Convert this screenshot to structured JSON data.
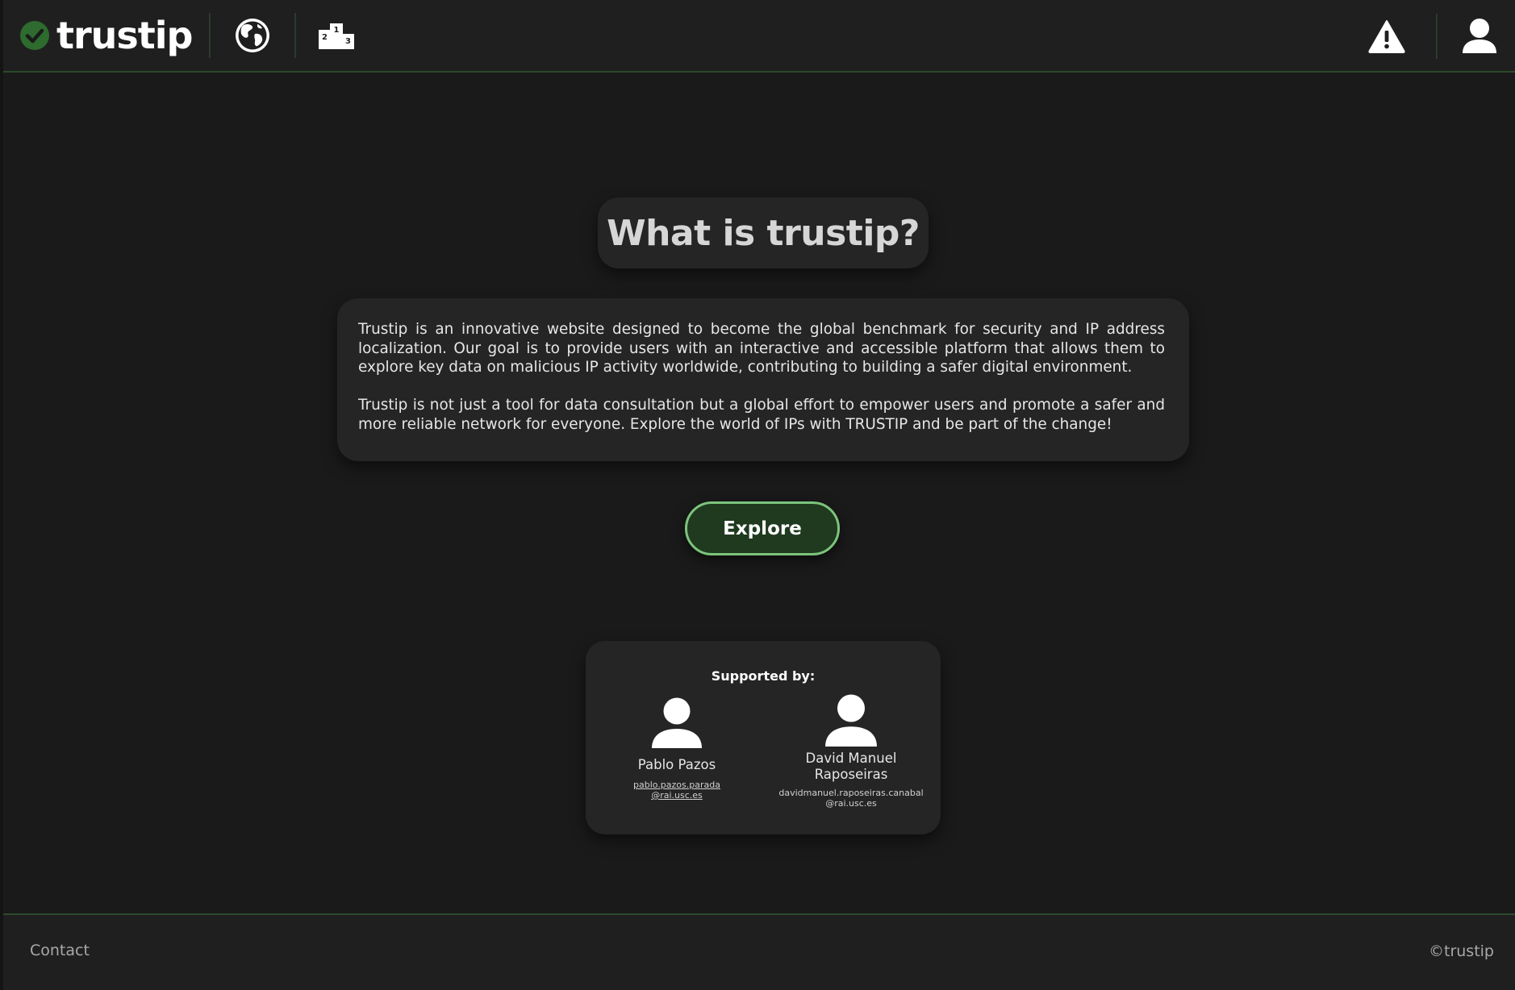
{
  "header": {
    "logo_text": "trustip",
    "logo_icon": "check-circle-icon",
    "nav": [
      {
        "icon": "globe-icon"
      },
      {
        "icon": "podium-icon",
        "ranks": [
          "1",
          "2",
          "3"
        ]
      }
    ],
    "right_icons": [
      "warning-icon",
      "user-icon"
    ]
  },
  "main": {
    "title": "What is trustip?",
    "paragraphs": [
      "Trustip is an innovative website designed to become the global benchmark for security and IP address localization. Our goal is to provide users with an interactive and accessible platform that allows them to explore key data on malicious IP activity worldwide, contributing to building a safer digital environment.",
      "Trustip is not just a tool for data consultation but a global effort to empower users and promote a safer and more reliable network for everyone. Explore the world of IPs with TRUSTIP and be part of the change!"
    ],
    "explore_label": "Explore"
  },
  "supporters": {
    "title": "Supported by:",
    "people": [
      {
        "name": "Pablo Pazos",
        "email_line1": "pablo.pazos.parada",
        "email_line2": "@rai.usc.es"
      },
      {
        "name_line1": "David Manuel",
        "name_line2": "Raposeiras",
        "email_line1": "davidmanuel.raposeiras.canabal",
        "email_line2": "@rai.usc.es"
      }
    ]
  },
  "footer": {
    "contact_label": "Contact",
    "copyright": "©trustip"
  },
  "colors": {
    "background": "#1a1a1a",
    "panel": "#252525",
    "accent_green": "#7cc47c",
    "button_fill": "#1f3a1f",
    "logo_check": "#2e6b2e"
  }
}
